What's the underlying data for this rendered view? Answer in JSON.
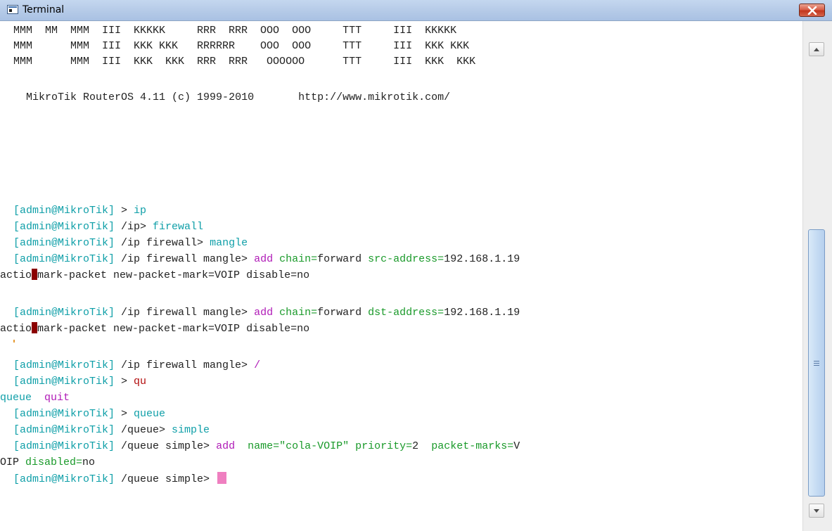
{
  "window": {
    "title": "Terminal",
    "close_label": "close"
  },
  "banner": [
    "MMM  MM  MMM  III  KKKKK     RRR  RRR  OOO  OOO     TTT     III  KKKKK",
    "MMM      MMM  III  KKK KKK   RRRRRR    OOO  OOO     TTT     III  KKK KKK",
    "MMM      MMM  III  KKK  KKK  RRR  RRR   OOOOOO      TTT     III  KKK  KKK"
  ],
  "version": "MikroTik RouterOS 4.11 (c) 1999-2010",
  "url": "http://www.mikrotik.com/",
  "prompt_user": "[admin@MikroTik]",
  "session": [
    {
      "path": " > ",
      "cmd": "ip",
      "cmd_color": "cyan"
    },
    {
      "path": " /ip> ",
      "cmd": "firewall",
      "cmd_color": "cyan"
    },
    {
      "path": " /ip firewall> ",
      "cmd": "mangle",
      "cmd_color": "cyan"
    },
    {
      "path": " /ip firewall mangle> ",
      "verb": "add",
      "chain_key": "chain=",
      "chain_val": "forward",
      "addr_key": "src-address=",
      "addr_val": "192.168.1.19"
    },
    {
      "cont_a": "actio",
      "cont_b": "mark-packet new-packet-mark=VOIP disable=no"
    },
    {
      "path": " /ip firewall mangle> ",
      "verb": "add",
      "chain_key": "chain=",
      "chain_val": "forward",
      "addr_key": "dst-address=",
      "addr_val": "192.168.1.19"
    },
    {
      "cont_a": "actio",
      "cont_b": "mark-packet new-packet-mark=VOIP disable=no"
    },
    {
      "path": " /ip firewall mangle> ",
      "cmd": "/",
      "cmd_color": "purple"
    },
    {
      "path": " > ",
      "cmd": "qu",
      "cmd_color": "red"
    },
    {
      "completion_1": "queue",
      "completion_2": "quit"
    },
    {
      "path": " > ",
      "cmd": "queue",
      "cmd_color": "cyan"
    },
    {
      "path": " /queue> ",
      "cmd": "simple",
      "cmd_color": "cyan"
    },
    {
      "path": " /queue simple> ",
      "verb": "add",
      "name_key": "name=",
      "name_val": "\"cola-VOIP\"",
      "prio_key": "priority=",
      "prio_val": "2",
      "pm_key": "packet-marks=",
      "pm_val_a": "V"
    },
    {
      "pm_val_b": "OIP",
      "dis_key": "disabled=",
      "dis_val": "no"
    },
    {
      "path": " /queue simple> "
    }
  ],
  "colors": {
    "prompt": "#0f9fa8",
    "verb": "#b01bb7",
    "key": "#1a9a2a",
    "error": "#b30e0e",
    "cursor": "#ef7fc0"
  },
  "icons": {
    "app": "terminal-window-icon",
    "close": "close-x-icon",
    "scroll_up": "arrow-up-icon",
    "scroll_down": "arrow-down-icon",
    "grip": "scroll-grip-icon"
  }
}
